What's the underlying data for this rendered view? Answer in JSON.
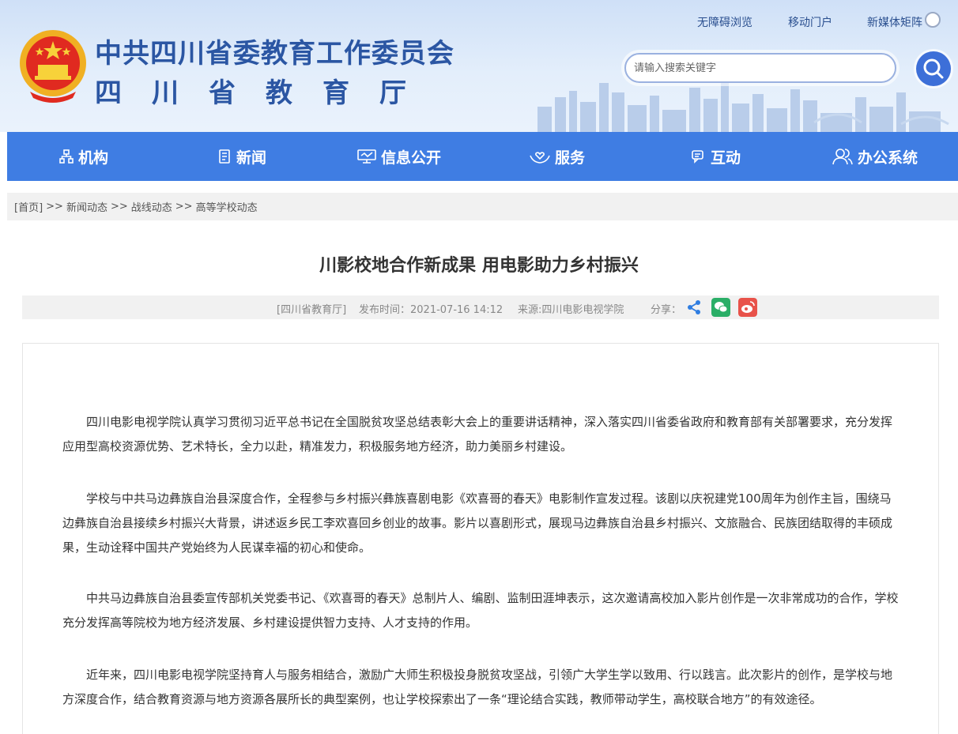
{
  "header": {
    "title_main": "中共四川省委教育工作委员会",
    "title_sub": "四川省教育厅",
    "top_links": [
      "无障碍浏览",
      "移动门户",
      "新媒体矩阵"
    ],
    "search_placeholder": "请输入搜索关键字"
  },
  "nav": {
    "items": [
      {
        "label": "机构",
        "icon": "org-icon"
      },
      {
        "label": "新闻",
        "icon": "news-icon"
      },
      {
        "label": "信息公开",
        "icon": "monitor-icon"
      },
      {
        "label": "服务",
        "icon": "hands-icon"
      },
      {
        "label": "互动",
        "icon": "chat-icon"
      },
      {
        "label": "办公系统",
        "icon": "users-icon"
      }
    ]
  },
  "breadcrumb": {
    "home": "[首页]",
    "sep": ">>",
    "items": [
      "新闻动态",
      "战线动态",
      "高等学校动态"
    ]
  },
  "article": {
    "title": "川影校地合作新成果 用电影助力乡村振兴",
    "meta_site": "[四川省教育厅]",
    "meta_time": "发布时间：2021-07-16 14:12",
    "meta_source": "来源:四川电影电视学院",
    "share_label": "分享：",
    "paragraphs": [
      "四川电影电视学院认真学习贯彻习近平总书记在全国脱贫攻坚总结表彰大会上的重要讲话精神，深入落实四川省委省政府和教育部有关部署要求，充分发挥应用型高校资源优势、艺术特长，全力以赴，精准发力，积极服务地方经济，助力美丽乡村建设。",
      "学校与中共马边彝族自治县深度合作，全程参与乡村振兴彝族喜剧电影《欢喜哥的春天》电影制作宣发过程。该剧以庆祝建党100周年为创作主旨，围绕马边彝族自治县接续乡村振兴大背景，讲述返乡民工李欢喜回乡创业的故事。影片以喜剧形式，展现马边彝族自治县乡村振兴、文旅融合、民族团结取得的丰硕成果，生动诠释中国共产党始终为人民谋幸福的初心和使命。",
      "中共马边彝族自治县委宣传部机关党委书记、《欢喜哥的春天》总制片人、编剧、监制田涯坤表示，这次邀请高校加入影片创作是一次非常成功的合作，学校充分发挥高等院校为地方经济发展、乡村建设提供智力支持、人才支持的作用。",
      "近年来，四川电影电视学院坚持育人与服务相结合，激励广大师生积极投身脱贫攻坚战，引领广大学生学以致用、行以践言。此次影片的创作，是学校与地方深度合作，结合教育资源与地方资源各展所长的典型案例，也让学校探索出了一条“理论结合实践，教师带动学生，高校联合地方”的有效途径。"
    ]
  },
  "colors": {
    "nav_bg": "#3f7de3",
    "title_blue": "#2b56a3",
    "wechat": "#2aae67",
    "weibo": "#e8524a",
    "share": "#2f7de1"
  }
}
